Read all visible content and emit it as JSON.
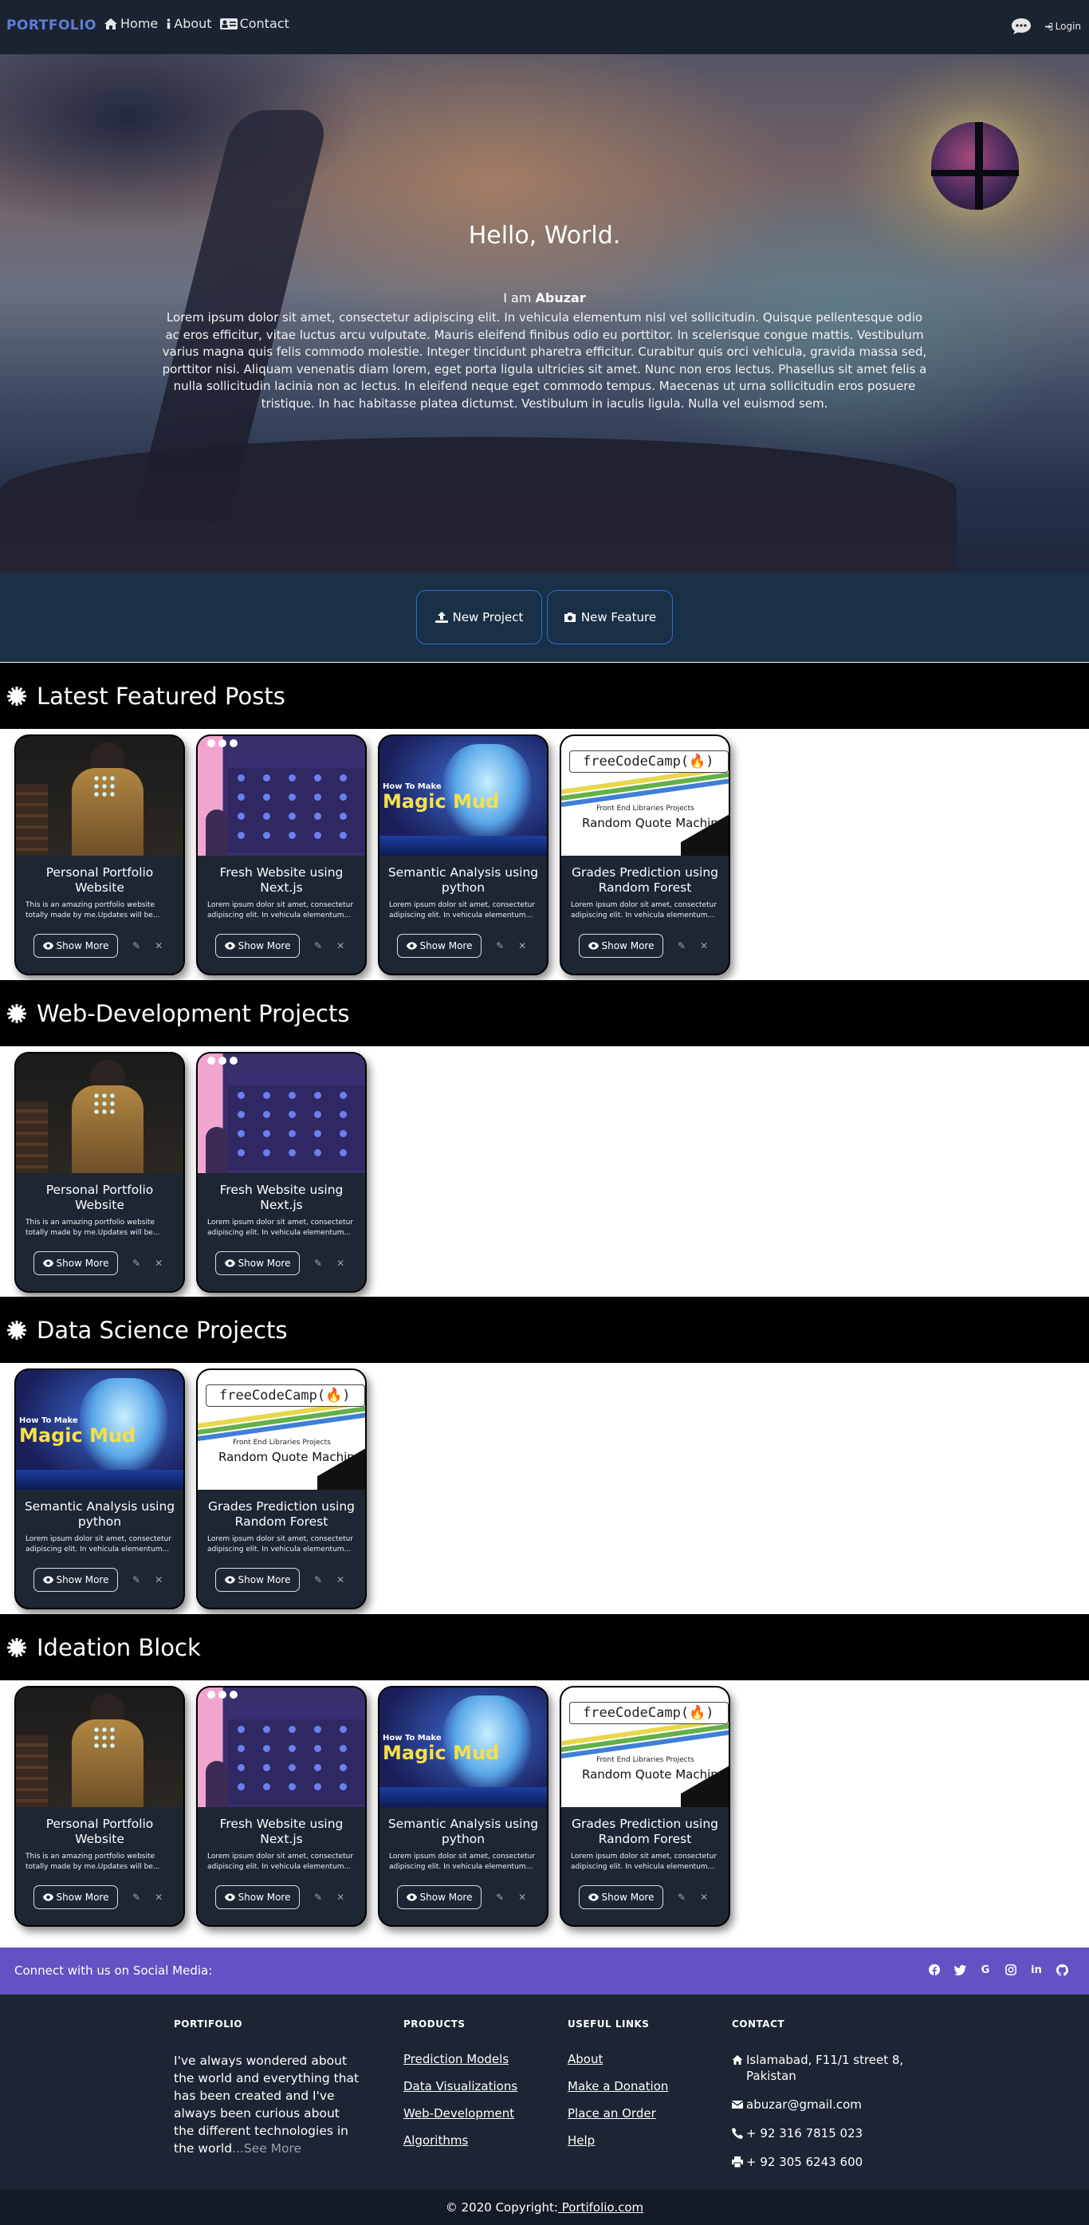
{
  "nav": {
    "brand": "PORTFOLIO",
    "links": [
      {
        "label": "Home",
        "icon": "home-icon"
      },
      {
        "label": "About",
        "icon": "info-icon"
      },
      {
        "label": "Contact",
        "icon": "contact-card-icon"
      }
    ],
    "login_label": "Login"
  },
  "hero": {
    "title": "Hello, World.",
    "intro_prefix": "I am ",
    "name": "Abuzar",
    "text": "Lorem ipsum dolor sit amet, consectetur adipiscing elit. In vehicula elementum nisl vel sollicitudin. Quisque pellentesque odio ac eros efficitur, vitae luctus arcu vulputate. Mauris eleifend finibus odio eu porttitor. In scelerisque congue mattis. Vestibulum varius magna quis felis commodo molestie. Integer tincidunt pharetra efficitur. Curabitur quis orci vehicula, gravida massa sed, porttitor nisi. Aliquam venenatis diam lorem, eget porta ligula ultricies sit amet. Nunc non eros lectus. Phasellus sit amet felis a nulla sollicitudin lacinia non ac lectus. In eleifend neque eget commodo tempus. Maecenas ut urna sollicitudin eros posuere tristique. In hac habitasse platea dictumst. Vestibulum in iaculis ligula. Nulla vel euismod sem."
  },
  "actions": {
    "new_project": "New Project",
    "new_feature": "New Feature"
  },
  "card_texts": {
    "show_more": "Show More",
    "edit_icon": "✎",
    "delete_icon": "✕",
    "portfolio_title": "Personal Portfolio Website",
    "portfolio_desc": "This is an amazing portfolio website totally made by me.Updates will be...",
    "next_title": "Fresh Website using Next.js",
    "lorem_desc": "Lorem ipsum dolor sit amet, consectetur adipiscing elit. In vehicula elementum...",
    "semantic_title": "Semantic Analysis using python",
    "grades_title": "Grades Prediction using Random Forest",
    "mud_line1": "How To Make",
    "mud_line2": "Magic Mud",
    "fcc_logo": "freeCodeCamp(🔥)",
    "fcc_sub": "Front End Libraries Projects",
    "fcc_main": "Random Quote Machine"
  },
  "sections": [
    {
      "title": "Latest Featured Posts"
    },
    {
      "title": "Web-Development Projects"
    },
    {
      "title": "Data Science Projects"
    },
    {
      "title": "Ideation Block"
    }
  ],
  "social": {
    "label": "Connect with us on Social Media:",
    "icons": [
      "facebook-icon",
      "twitter-icon",
      "google-icon",
      "instagram-icon",
      "linkedin-icon",
      "github-icon"
    ]
  },
  "footer": {
    "col1_title": "PORTIFOLIO",
    "about_text": "I've always wondered about the world and everything that has been created and I've always been curious about the different technologies in the world",
    "about_more": "...See More",
    "col2_title": "PRODUCTS",
    "products": [
      "Prediction Models",
      "Data Visualizations",
      "Web-Development",
      "Algorithms"
    ],
    "col3_title": "USEFUL LINKS",
    "useful_links": [
      "About",
      "Make a Donation",
      "Place an Order",
      "Help"
    ],
    "col4_title": "CONTACT",
    "address": "Islamabad, F11/1 street 8, Pakistan",
    "email": "abuzar@gmail.com",
    "phone": "+ 92 316 7815 023",
    "fax": "+ 92 305 6243 600"
  },
  "copyright": {
    "prefix": "© 2020 Copyright:",
    "link": " Portifolio.com"
  },
  "colors": {
    "nav_bg": "#1c2330",
    "brand": "#5b7fd6",
    "action_bar_bg": "#1a3046",
    "button_border": "#2d6bd6",
    "section_head_bg": "#000000",
    "card_bg": "#1e2634",
    "social_bar": "#6352c4",
    "footer_bg": "#1d2433",
    "copyright_bg": "#141a26"
  }
}
